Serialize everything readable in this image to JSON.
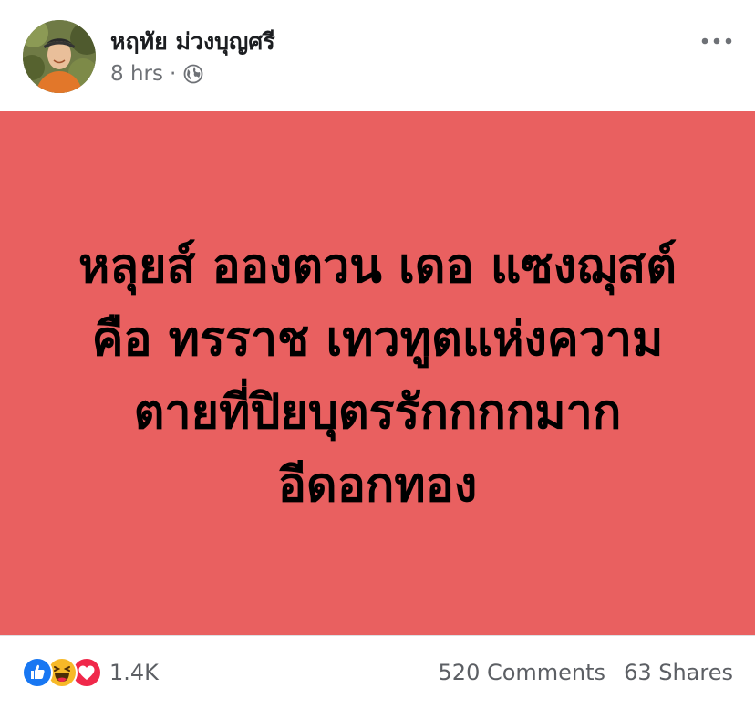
{
  "post": {
    "author": "หฤทัย ม่วงบุญศรี",
    "timestamp": "8 hrs",
    "separator": "·",
    "privacy_icon": "globe-icon",
    "more_icon": "ellipsis-icon",
    "status_lines": [
      "หลุยส์ อองตวน เดอ แซงฌุสต์",
      "คือ ทรราช เทวทูตแห่งความ",
      "ตายที่ปิยบุตรรักกกกมาก",
      "อีดอกทอง"
    ],
    "background_color": "#e96060"
  },
  "footer": {
    "reaction_icons": [
      "like-icon",
      "haha-icon",
      "love-icon"
    ],
    "reaction_count": "1.4K",
    "comments": "520 Comments",
    "shares": "63 Shares"
  }
}
